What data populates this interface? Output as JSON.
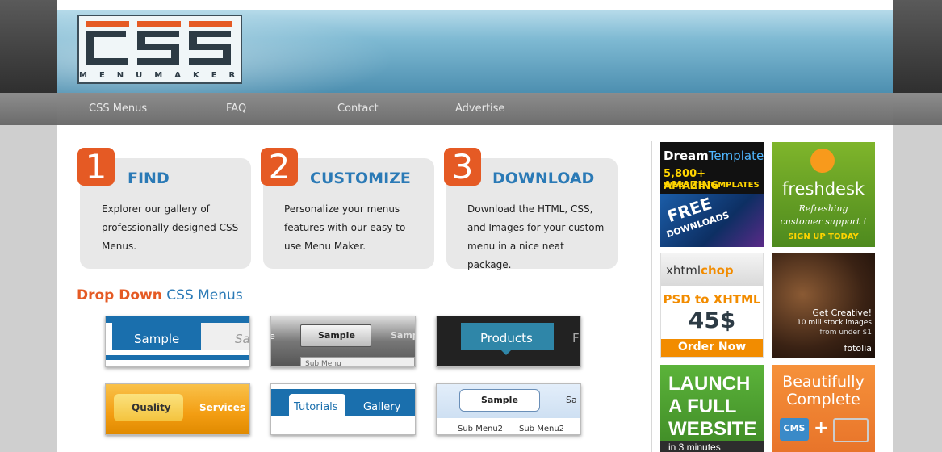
{
  "logo": {
    "word": "MENUMAKER",
    "letters": "CSS"
  },
  "nav": {
    "items": [
      "CSS Menus",
      "FAQ",
      "Contact",
      "Advertise"
    ]
  },
  "steps": [
    {
      "num": "1",
      "title": "FIND",
      "desc": "Explorer our gallery of professionally designed CSS Menus."
    },
    {
      "num": "2",
      "title": "CUSTOMIZE",
      "desc": "Personalize your menus features with our easy to use Menu Maker."
    },
    {
      "num": "3",
      "title": "DOWNLOAD",
      "desc": "Download the HTML, CSS, and Images for your custom menu in a nice neat package."
    }
  ],
  "dropdown": {
    "heading_a": "Drop Down",
    "heading_b": "CSS Menus"
  },
  "thumbs": {
    "t1": {
      "item1": "Sample",
      "item2": "Sa"
    },
    "t2": {
      "item0": "e",
      "item1": "Sample",
      "item2": "Samp",
      "sub": "Sub Menu"
    },
    "t3": {
      "item1": "Products",
      "item2": "F"
    },
    "t4": {
      "item1": "Quality",
      "item2": "Services"
    },
    "t5": {
      "item1": "Tutorials",
      "item2": "Gallery"
    },
    "t6": {
      "item1": "Sample",
      "item2": "Sa",
      "sub1": "Sub Menu2",
      "sub2": "Sub Menu2"
    }
  },
  "ads": {
    "dreamtemplate": {
      "brand_a": "Dream",
      "brand_b": "Template",
      "line1": "5,800+ AMAZING",
      "line2": "WEBSITE TEMPLATES",
      "badge": "FREE",
      "badge2": "DOWNLOADS"
    },
    "freshdesk": {
      "brand": "freshdesk",
      "line1": "Refreshing",
      "line2": "customer support !",
      "cta": "SIGN UP TODAY"
    },
    "xhtmlchop": {
      "brand_a": "xhtml",
      "brand_b": "chop",
      "line1": "PSD to XHTML",
      "price": "45$",
      "cta": "Order Now"
    },
    "fotolia": {
      "line1": "Get Creative!",
      "line2": "10 mill stock images",
      "line3": "from under $1",
      "brand": "fotolia"
    },
    "launch": {
      "line1": "LAUNCH",
      "line2": "A FULL",
      "line3": "WEBSITE",
      "line4": "in 3 minutes"
    },
    "cms": {
      "line1": "Beautifully",
      "line2": "Complete",
      "badge": "CMS",
      "plus": "+"
    }
  },
  "colors": {
    "accent": "#e55a24",
    "blue": "#2b7ab6"
  }
}
